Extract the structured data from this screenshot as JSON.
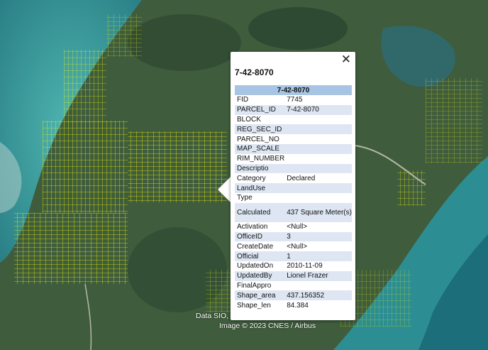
{
  "map": {
    "attribution_data": "Data SIO,",
    "attribution_image": "Image © 2023 CNES / Airbus",
    "overlay_color": "#f4f400"
  },
  "popup": {
    "title": "7-42-8070",
    "table_header": "7-42-8070",
    "close_icon": "✕",
    "rows": [
      {
        "key": "FID",
        "value": "7745"
      },
      {
        "key": "PARCEL_ID",
        "value": "7-42-8070"
      },
      {
        "key": "BLOCK",
        "value": ""
      },
      {
        "key": "REG_SEC_ID",
        "value": ""
      },
      {
        "key": "PARCEL_NO",
        "value": ""
      },
      {
        "key": "MAP_SCALE",
        "value": ""
      },
      {
        "key": "RIM_NUMBER",
        "value": ""
      },
      {
        "key": "Descriptio",
        "value": ""
      },
      {
        "key": "Category",
        "value": "Declared"
      },
      {
        "key": "LandUse",
        "value": ""
      },
      {
        "key": "Type",
        "value": ""
      },
      {
        "key": "Calculated",
        "value": "437 Square Meter(s)"
      },
      {
        "key": "Activation",
        "value": "<Null>"
      },
      {
        "key": "OfficeID",
        "value": "3"
      },
      {
        "key": "CreateDate",
        "value": "<Null>"
      },
      {
        "key": "Official",
        "value": "1"
      },
      {
        "key": "UpdatedOn",
        "value": "2010-11-09"
      },
      {
        "key": "UpdatedBy",
        "value": "Lionel Frazer"
      },
      {
        "key": "FinalAppro",
        "value": ""
      },
      {
        "key": "Shape_area",
        "value": "437.156352"
      },
      {
        "key": "Shape_len",
        "value": "84.384"
      }
    ]
  }
}
